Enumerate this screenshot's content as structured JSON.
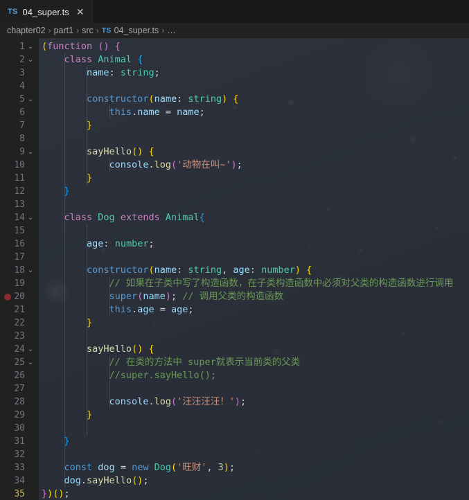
{
  "tab": {
    "file_type_badge": "TS",
    "filename": "04_super.ts",
    "close_glyph": "✕"
  },
  "breadcrumb": {
    "separator": "›",
    "ts_badge": "TS",
    "items": [
      "chapter02",
      "part1",
      "src",
      "04_super.ts",
      "…"
    ]
  },
  "editor": {
    "fold_glyph": "⌄",
    "active_line": 35,
    "breakpoint_line": 20,
    "total_lines": 35,
    "lines": [
      {
        "n": 1,
        "fold": true,
        "indent": 0
      },
      {
        "n": 2,
        "fold": true,
        "indent": 1
      },
      {
        "n": 3,
        "fold": false,
        "indent": 2
      },
      {
        "n": 4,
        "fold": false,
        "indent": 2
      },
      {
        "n": 5,
        "fold": true,
        "indent": 2
      },
      {
        "n": 6,
        "fold": false,
        "indent": 3
      },
      {
        "n": 7,
        "fold": false,
        "indent": 2
      },
      {
        "n": 8,
        "fold": false,
        "indent": 2
      },
      {
        "n": 9,
        "fold": true,
        "indent": 2
      },
      {
        "n": 10,
        "fold": false,
        "indent": 3
      },
      {
        "n": 11,
        "fold": false,
        "indent": 2
      },
      {
        "n": 12,
        "fold": false,
        "indent": 1
      },
      {
        "n": 13,
        "fold": false,
        "indent": 1
      },
      {
        "n": 14,
        "fold": true,
        "indent": 1
      },
      {
        "n": 15,
        "fold": false,
        "indent": 2
      },
      {
        "n": 16,
        "fold": false,
        "indent": 2
      },
      {
        "n": 17,
        "fold": false,
        "indent": 2
      },
      {
        "n": 18,
        "fold": true,
        "indent": 2
      },
      {
        "n": 19,
        "fold": false,
        "indent": 3
      },
      {
        "n": 20,
        "fold": false,
        "indent": 3
      },
      {
        "n": 21,
        "fold": false,
        "indent": 3
      },
      {
        "n": 22,
        "fold": false,
        "indent": 2
      },
      {
        "n": 23,
        "fold": false,
        "indent": 2
      },
      {
        "n": 24,
        "fold": true,
        "indent": 2
      },
      {
        "n": 25,
        "fold": true,
        "indent": 3
      },
      {
        "n": 26,
        "fold": false,
        "indent": 3
      },
      {
        "n": 27,
        "fold": false,
        "indent": 3
      },
      {
        "n": 28,
        "fold": false,
        "indent": 3
      },
      {
        "n": 29,
        "fold": false,
        "indent": 2
      },
      {
        "n": 30,
        "fold": false,
        "indent": 2
      },
      {
        "n": 31,
        "fold": false,
        "indent": 1
      },
      {
        "n": 32,
        "fold": false,
        "indent": 1
      },
      {
        "n": 33,
        "fold": false,
        "indent": 1
      },
      {
        "n": 34,
        "fold": false,
        "indent": 1
      },
      {
        "n": 35,
        "fold": false,
        "indent": 0
      }
    ],
    "code": [
      [
        {
          "t": "(",
          "c": "t-br1"
        },
        {
          "t": "function",
          "c": "t-kw2"
        },
        {
          "t": " ",
          "c": "t-plain"
        },
        {
          "t": "()",
          "c": "t-br2"
        },
        {
          "t": " ",
          "c": "t-plain"
        },
        {
          "t": "{",
          "c": "t-br2"
        }
      ],
      [
        {
          "t": "    ",
          "c": "t-plain"
        },
        {
          "t": "class",
          "c": "t-kw2"
        },
        {
          "t": " ",
          "c": "t-plain"
        },
        {
          "t": "Animal",
          "c": "t-type"
        },
        {
          "t": " ",
          "c": "t-plain"
        },
        {
          "t": "{",
          "c": "t-br3"
        }
      ],
      [
        {
          "t": "        ",
          "c": "t-plain"
        },
        {
          "t": "name",
          "c": "t-var"
        },
        {
          "t": ": ",
          "c": "t-plain"
        },
        {
          "t": "string",
          "c": "t-type"
        },
        {
          "t": ";",
          "c": "t-plain"
        }
      ],
      [],
      [
        {
          "t": "        ",
          "c": "t-plain"
        },
        {
          "t": "constructor",
          "c": "t-kw"
        },
        {
          "t": "(",
          "c": "t-br1"
        },
        {
          "t": "name",
          "c": "t-var"
        },
        {
          "t": ": ",
          "c": "t-plain"
        },
        {
          "t": "string",
          "c": "t-type"
        },
        {
          "t": ")",
          "c": "t-br1"
        },
        {
          "t": " ",
          "c": "t-plain"
        },
        {
          "t": "{",
          "c": "t-br1"
        }
      ],
      [
        {
          "t": "            ",
          "c": "t-plain"
        },
        {
          "t": "this",
          "c": "t-this"
        },
        {
          "t": ".",
          "c": "t-plain"
        },
        {
          "t": "name",
          "c": "t-var"
        },
        {
          "t": " = ",
          "c": "t-plain"
        },
        {
          "t": "name",
          "c": "t-var"
        },
        {
          "t": ";",
          "c": "t-plain"
        }
      ],
      [
        {
          "t": "        ",
          "c": "t-plain"
        },
        {
          "t": "}",
          "c": "t-br1"
        }
      ],
      [],
      [
        {
          "t": "        ",
          "c": "t-plain"
        },
        {
          "t": "sayHello",
          "c": "t-fn"
        },
        {
          "t": "()",
          "c": "t-br1"
        },
        {
          "t": " ",
          "c": "t-plain"
        },
        {
          "t": "{",
          "c": "t-br1"
        }
      ],
      [
        {
          "t": "            ",
          "c": "t-plain"
        },
        {
          "t": "console",
          "c": "t-var"
        },
        {
          "t": ".",
          "c": "t-plain"
        },
        {
          "t": "log",
          "c": "t-fn"
        },
        {
          "t": "(",
          "c": "t-br2"
        },
        {
          "t": "'动物在叫~'",
          "c": "t-str"
        },
        {
          "t": ")",
          "c": "t-br2"
        },
        {
          "t": ";",
          "c": "t-plain"
        }
      ],
      [
        {
          "t": "        ",
          "c": "t-plain"
        },
        {
          "t": "}",
          "c": "t-br1"
        }
      ],
      [
        {
          "t": "    ",
          "c": "t-plain"
        },
        {
          "t": "}",
          "c": "t-br3"
        }
      ],
      [],
      [
        {
          "t": "    ",
          "c": "t-plain"
        },
        {
          "t": "class",
          "c": "t-kw2"
        },
        {
          "t": " ",
          "c": "t-plain"
        },
        {
          "t": "Dog",
          "c": "t-type"
        },
        {
          "t": " ",
          "c": "t-plain"
        },
        {
          "t": "extends",
          "c": "t-kw2"
        },
        {
          "t": " ",
          "c": "t-plain"
        },
        {
          "t": "Animal",
          "c": "t-type"
        },
        {
          "t": "{",
          "c": "t-br3"
        }
      ],
      [],
      [
        {
          "t": "        ",
          "c": "t-plain"
        },
        {
          "t": "age",
          "c": "t-var"
        },
        {
          "t": ": ",
          "c": "t-plain"
        },
        {
          "t": "number",
          "c": "t-type"
        },
        {
          "t": ";",
          "c": "t-plain"
        }
      ],
      [],
      [
        {
          "t": "        ",
          "c": "t-plain"
        },
        {
          "t": "constructor",
          "c": "t-kw"
        },
        {
          "t": "(",
          "c": "t-br1"
        },
        {
          "t": "name",
          "c": "t-var"
        },
        {
          "t": ": ",
          "c": "t-plain"
        },
        {
          "t": "string",
          "c": "t-type"
        },
        {
          "t": ", ",
          "c": "t-plain"
        },
        {
          "t": "age",
          "c": "t-var"
        },
        {
          "t": ": ",
          "c": "t-plain"
        },
        {
          "t": "number",
          "c": "t-type"
        },
        {
          "t": ")",
          "c": "t-br1"
        },
        {
          "t": " ",
          "c": "t-plain"
        },
        {
          "t": "{",
          "c": "t-br1"
        }
      ],
      [
        {
          "t": "            ",
          "c": "t-plain"
        },
        {
          "t": "// 如果在子类中写了构造函数，在子类构造函数中必须对父类的构造函数进行调用",
          "c": "t-com"
        }
      ],
      [
        {
          "t": "            ",
          "c": "t-plain"
        },
        {
          "t": "super",
          "c": "t-kw"
        },
        {
          "t": "(",
          "c": "t-br2"
        },
        {
          "t": "name",
          "c": "t-var"
        },
        {
          "t": ")",
          "c": "t-br2"
        },
        {
          "t": "; ",
          "c": "t-plain"
        },
        {
          "t": "// 调用父类的构造函数",
          "c": "t-com"
        }
      ],
      [
        {
          "t": "            ",
          "c": "t-plain"
        },
        {
          "t": "this",
          "c": "t-this"
        },
        {
          "t": ".",
          "c": "t-plain"
        },
        {
          "t": "age",
          "c": "t-var"
        },
        {
          "t": " = ",
          "c": "t-plain"
        },
        {
          "t": "age",
          "c": "t-var"
        },
        {
          "t": ";",
          "c": "t-plain"
        }
      ],
      [
        {
          "t": "        ",
          "c": "t-plain"
        },
        {
          "t": "}",
          "c": "t-br1"
        }
      ],
      [],
      [
        {
          "t": "        ",
          "c": "t-plain"
        },
        {
          "t": "sayHello",
          "c": "t-fn"
        },
        {
          "t": "()",
          "c": "t-br1"
        },
        {
          "t": " ",
          "c": "t-plain"
        },
        {
          "t": "{",
          "c": "t-br1"
        }
      ],
      [
        {
          "t": "            ",
          "c": "t-plain"
        },
        {
          "t": "// 在类的方法中 super就表示当前类的父类",
          "c": "t-com"
        }
      ],
      [
        {
          "t": "            ",
          "c": "t-plain"
        },
        {
          "t": "//super.sayHello();",
          "c": "t-com"
        }
      ],
      [],
      [
        {
          "t": "            ",
          "c": "t-plain"
        },
        {
          "t": "console",
          "c": "t-var"
        },
        {
          "t": ".",
          "c": "t-plain"
        },
        {
          "t": "log",
          "c": "t-fn"
        },
        {
          "t": "(",
          "c": "t-br2"
        },
        {
          "t": "'汪汪汪汪！'",
          "c": "t-str"
        },
        {
          "t": ")",
          "c": "t-br2"
        },
        {
          "t": ";",
          "c": "t-plain"
        }
      ],
      [
        {
          "t": "        ",
          "c": "t-plain"
        },
        {
          "t": "}",
          "c": "t-br1"
        }
      ],
      [],
      [
        {
          "t": "    ",
          "c": "t-plain"
        },
        {
          "t": "}",
          "c": "t-br3"
        }
      ],
      [],
      [
        {
          "t": "    ",
          "c": "t-plain"
        },
        {
          "t": "const",
          "c": "t-kw"
        },
        {
          "t": " ",
          "c": "t-plain"
        },
        {
          "t": "dog",
          "c": "t-var"
        },
        {
          "t": " = ",
          "c": "t-plain"
        },
        {
          "t": "new",
          "c": "t-kw"
        },
        {
          "t": " ",
          "c": "t-plain"
        },
        {
          "t": "Dog",
          "c": "t-type"
        },
        {
          "t": "(",
          "c": "t-br1"
        },
        {
          "t": "'旺财'",
          "c": "t-str"
        },
        {
          "t": ", ",
          "c": "t-plain"
        },
        {
          "t": "3",
          "c": "t-num"
        },
        {
          "t": ")",
          "c": "t-br1"
        },
        {
          "t": ";",
          "c": "t-plain"
        }
      ],
      [
        {
          "t": "    ",
          "c": "t-plain"
        },
        {
          "t": "dog",
          "c": "t-var"
        },
        {
          "t": ".",
          "c": "t-plain"
        },
        {
          "t": "sayHello",
          "c": "t-fn"
        },
        {
          "t": "()",
          "c": "t-br1"
        },
        {
          "t": ";",
          "c": "t-plain"
        }
      ],
      [
        {
          "t": "}",
          "c": "t-br2"
        },
        {
          "t": ")",
          "c": "t-br1"
        },
        {
          "t": "()",
          "c": "t-br1"
        },
        {
          "t": ";",
          "c": "t-plain"
        }
      ]
    ]
  }
}
